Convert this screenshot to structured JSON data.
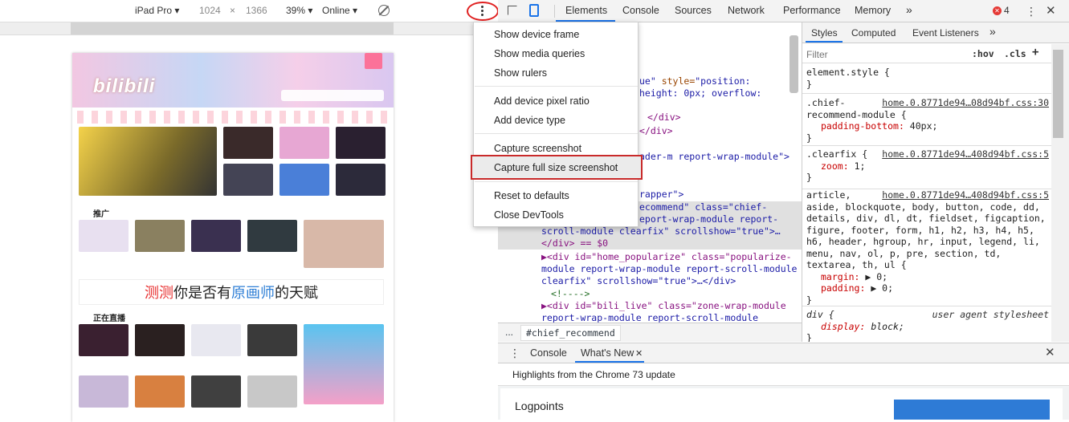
{
  "device_toolbar": {
    "device": "iPad Pro ▾",
    "width": "1024",
    "times": "×",
    "height": "1366",
    "zoom": "39% ▾",
    "network": "Online ▾"
  },
  "devtools_tabs": [
    "Elements",
    "Console",
    "Sources",
    "Network",
    "Performance",
    "Memory"
  ],
  "more_tabs": "»",
  "error_count": "4",
  "menu": {
    "items": [
      "Show device frame",
      "Show media queries",
      "Show rulers",
      "Add device pixel ratio",
      "Add device type",
      "Capture screenshot",
      "Capture full size screenshot",
      "Reset to defaults",
      "Close DevTools"
    ]
  },
  "elements": {
    "lines": [
      {
        "t": "ue\" ",
        "k": "val",
        "rest_attr": "style=",
        "rest_val": "\"position:"
      },
      {
        "t": "height: 0px; overflow:",
        "k": "val"
      },
      {
        "t": "</div>",
        "k": "tag"
      },
      {
        "t": "</div>",
        "k": "tag"
      },
      {
        "t": "ader-m report-wrap-module\">",
        "k": "val"
      },
      {
        "t": "rapper\">",
        "k": "val"
      },
      {
        "t": "ecommend\" class=\"chief-",
        "k": "val"
      },
      {
        "t": "eport-wrap-module report-",
        "k": "val"
      },
      {
        "t": "scroll-module clearfix\" scrollshow=\"true\">…",
        "k": "val"
      },
      {
        "t": "</div> == $0",
        "k": "tag"
      },
      {
        "t": "▶<div id=\"home_popularize\" class=\"popularize-",
        "k": "tag"
      },
      {
        "t": "module report-wrap-module report-scroll-module",
        "k": "val"
      },
      {
        "t": "clearfix\" scrollshow=\"true\">…</div>",
        "k": "val"
      },
      {
        "t": "<!---->",
        "k": "cmt"
      },
      {
        "t": "▶<div id=\"bili_live\" class=\"zone-wrap-module",
        "k": "tag"
      },
      {
        "t": "report-wrap-module report-scroll-module",
        "k": "val"
      }
    ]
  },
  "breadcrumb": {
    "ellipsis": "...",
    "crumb": "#chief_recommend"
  },
  "styles_tabs": [
    "Styles",
    "Computed",
    "Event Listeners"
  ],
  "styles_more": "»",
  "filter": {
    "placeholder": "Filter",
    "hov": ":hov",
    "cls": ".cls",
    "plus": "+"
  },
  "rules": [
    {
      "selector": "element.style {",
      "source": "",
      "props": [],
      "close": "}"
    },
    {
      "selector": ".chief-\nrecommend-module {",
      "source": "home.0.8771de94…08d94bf.css:30",
      "props": [
        [
          "padding-bottom",
          "40px;"
        ]
      ],
      "close": "}"
    },
    {
      "selector": ".clearfix {",
      "source": "home.0.8771de94…408d94bf.css:5",
      "props": [
        [
          "zoom",
          "1;"
        ]
      ],
      "close": "}"
    },
    {
      "selector": "article,",
      "source": "home.0.8771de94…408d94bf.css:5",
      "extra": "aside, blockquote, body, button, code, dd, details, div, dl, dt, fieldset, figcaption, figure, footer, form, h1, h2, h3, h4, h5, h6, header, hgroup, hr, input, legend, li, menu, nav, ol, p, pre, section, td, textarea, th, ul {",
      "props": [
        [
          "margin",
          "▶ 0;"
        ],
        [
          "padding",
          "▶ 0;"
        ]
      ],
      "close": "}"
    },
    {
      "selector": "div {",
      "source": "user agent stylesheet",
      "props": [
        [
          "display",
          "block;"
        ]
      ],
      "close": "}"
    }
  ],
  "drawer": {
    "tabs": [
      "Console",
      "What's New"
    ],
    "close_tab": "✕",
    "subtitle": "Highlights from the Chrome 73 update",
    "heading": "Logpoints"
  },
  "site": {
    "logo": "bilibili",
    "section_recommend": "推广",
    "section_live": "正在直播",
    "ad_parts": [
      "测测",
      "你是否有",
      "原画师",
      "的天赋"
    ]
  },
  "colors": {
    "accent": "#1a73e8",
    "highlight": "#c92a2a",
    "error": "#e53935"
  }
}
